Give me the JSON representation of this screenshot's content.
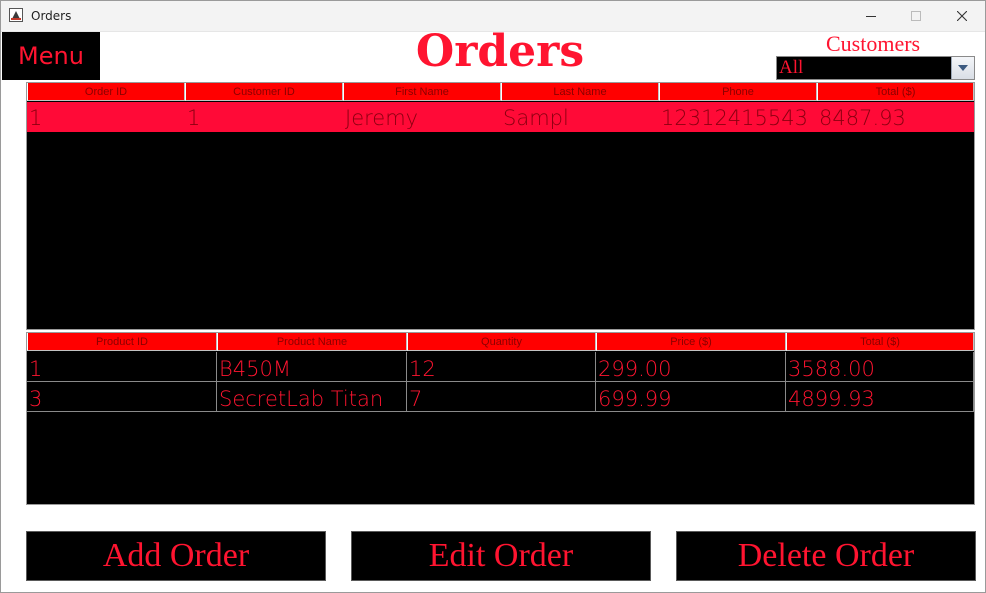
{
  "window": {
    "title": "Orders",
    "icon": "java-app-icon"
  },
  "header": {
    "menu_label": "Menu",
    "page_title": "Orders",
    "customers_label": "Customers",
    "customers_selected": "All"
  },
  "orders_table": {
    "columns": [
      "Order ID",
      "Customer ID",
      "First Name",
      "Last Name",
      "Phone",
      "Total ($)"
    ],
    "rows": [
      [
        "1",
        "1",
        "Jeremy",
        "Sampl",
        "12312415543",
        "8487.93"
      ]
    ]
  },
  "products_table": {
    "columns": [
      "Product ID",
      "Product Name",
      "Quantity",
      "Price ($)",
      "Total ($)"
    ],
    "rows": [
      [
        "1",
        "B450M",
        "12",
        "299.00",
        "3588.00"
      ],
      [
        "3",
        "SecretLab Titan",
        "7",
        "699.99",
        "4899.93"
      ]
    ]
  },
  "actions": {
    "add_label": "Add Order",
    "edit_label": "Edit Order",
    "delete_label": "Delete Order"
  },
  "colors": {
    "accent": "#ff1430",
    "header_bg": "#ff0000",
    "selected_row": "#ff0a37",
    "panel_bg": "#000000"
  }
}
